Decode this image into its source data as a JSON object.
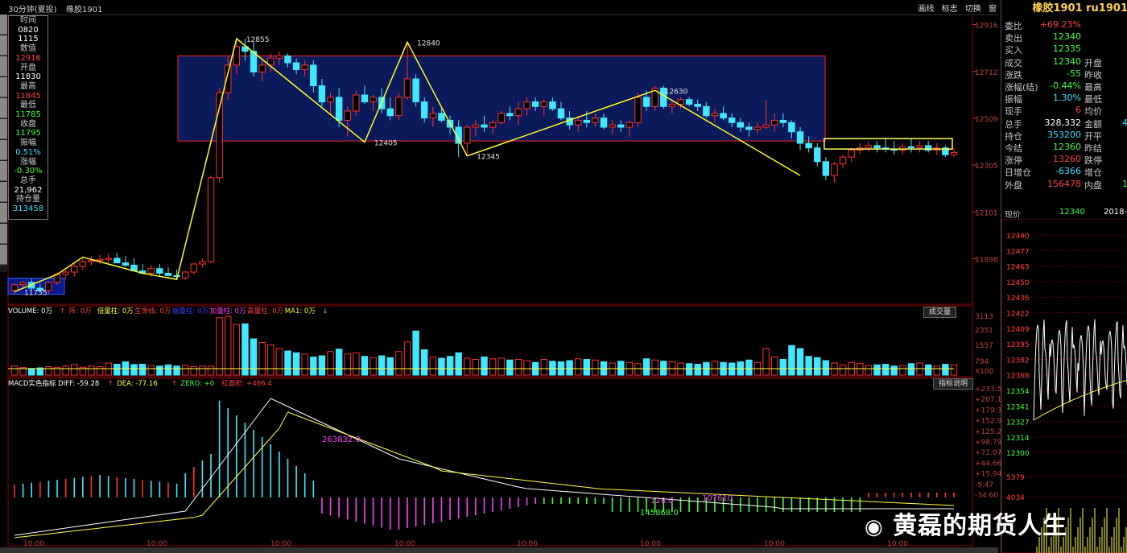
{
  "title_bar": {
    "period": "30分钟(夏投)",
    "symbol": "橡胶1901",
    "window_buttons": [
      "画线",
      "标志",
      "切换",
      "窗"
    ]
  },
  "info_box": {
    "rows": [
      {
        "text": "时间",
        "c": "g"
      },
      {
        "text": "0820",
        "c": "w"
      },
      {
        "text": "1115",
        "c": "w"
      },
      {
        "text": "数值",
        "c": "g"
      },
      {
        "text": "12916",
        "c": "r"
      },
      {
        "text": "开盘",
        "c": "g"
      },
      {
        "text": "11830",
        "c": "w"
      },
      {
        "text": "最高",
        "c": "g"
      },
      {
        "text": "11845",
        "c": "r"
      },
      {
        "text": "最低",
        "c": "g"
      },
      {
        "text": "11785",
        "c": "gr"
      },
      {
        "text": "收盘",
        "c": "g"
      },
      {
        "text": "11795",
        "c": "gr"
      },
      {
        "text": "振幅",
        "c": "g"
      },
      {
        "text": "0.51%",
        "c": "cy"
      },
      {
        "text": "涨幅",
        "c": "g"
      },
      {
        "text": "-0.30%",
        "c": "gr"
      },
      {
        "text": "总手",
        "c": "g"
      },
      {
        "text": "21,962",
        "c": "w"
      },
      {
        "text": "持仓量",
        "c": "g"
      },
      {
        "text": "313458",
        "c": "cy"
      }
    ]
  },
  "right_panel": {
    "title": "橡胶1901 ru1901",
    "rows": [
      {
        "l1": "委比",
        "v1": "+69.23%",
        "c1": "#ff4040",
        "l2": "",
        "v2": "",
        "c2": "#fff"
      },
      {
        "l1": "卖出",
        "v1": "12340",
        "c1": "#40ff40",
        "l2": "",
        "v2": "",
        "c2": "#fff"
      },
      {
        "l1": "买入",
        "v1": "12335",
        "c1": "#40ff40",
        "l2": "",
        "v2": "",
        "c2": "#fff"
      },
      {
        "l1": "成交",
        "v1": "12340",
        "c1": "#40ff40",
        "l2": "开盘",
        "v2": "",
        "c2": "#fff"
      },
      {
        "l1": "涨跌",
        "v1": "-55",
        "c1": "#40ff40",
        "l2": "昨收",
        "v2": "",
        "c2": "#fff"
      },
      {
        "l1": "涨幅(结)",
        "v1": "-0.44%",
        "c1": "#40ff40",
        "l2": "最高",
        "v2": "",
        "c2": "#fff"
      },
      {
        "l1": "振幅",
        "v1": "1.30%",
        "c1": "#40e0ff",
        "l2": "最低",
        "v2": "",
        "c2": "#fff"
      },
      {
        "l1": "现手",
        "v1": "6",
        "c1": "#ff4040",
        "l2": "均价",
        "v2": "",
        "c2": "#fff"
      },
      {
        "l1": "总手",
        "v1": "328,332",
        "c1": "#fff",
        "l2": "金额",
        "v2": "4",
        "c2": "#40e0ff"
      },
      {
        "l1": "持仓",
        "v1": "353200",
        "c1": "#40e0ff",
        "l2": "开平",
        "v2": "",
        "c2": "#fff"
      },
      {
        "l1": "今结",
        "v1": "12360",
        "c1": "#40ff40",
        "l2": "昨结",
        "v2": "",
        "c2": "#fff"
      },
      {
        "l1": "涨停",
        "v1": "13260",
        "c1": "#ff4040",
        "l2": "跌停",
        "v2": "",
        "c2": "#fff"
      },
      {
        "l1": "日增仓",
        "v1": "-6366",
        "c1": "#40e0ff",
        "l2": "增仓",
        "v2": "",
        "c2": "#fff"
      },
      {
        "l1": "外盘",
        "v1": "156478",
        "c1": "#ff4040",
        "l2": "内盘",
        "v2": "1",
        "c2": "#40ff40"
      }
    ],
    "price_label": "现价",
    "price_value": "12340",
    "date_label": "2018-0",
    "tick_labels": [
      "12490",
      "12477",
      "12463",
      "12450",
      "12436",
      "12422",
      "12409",
      "12395",
      "12382",
      "12368",
      "12354",
      "12341",
      "12327",
      "12314",
      "12300",
      "5379",
      "4034"
    ]
  },
  "buttons": {
    "volume_btn": "成交量",
    "macd_btn": "指标说明"
  },
  "indicator_legends": {
    "volume": [
      {
        "t": "VOLUME: 0万",
        "c": "#fff"
      },
      {
        "t": "↑",
        "c": "#ff4040"
      },
      {
        "t": "阵: 0万",
        "c": "#ff4040"
      },
      {
        "t": "倍量柱: 0万",
        "c": "#ffff40"
      },
      {
        "t": "生命线: 0万",
        "c": "#ff4040"
      },
      {
        "t": "缩量柱: 0万",
        "c": "#4040ff"
      },
      {
        "t": "加量柱: 0万",
        "c": "#ff40ff"
      },
      {
        "t": "高量柱: 0万",
        "c": "#ff4040"
      },
      {
        "t": "MA1: 0万",
        "c": "#ffff40"
      },
      {
        "t": "↓",
        "c": "#40e0ff"
      }
    ],
    "macd": [
      {
        "t": "MACD实色指标 DIFF: -59.28",
        "c": "#fff"
      },
      {
        "t": "↑",
        "c": "#ff4040"
      },
      {
        "t": "DEA: -77.16",
        "c": "#ffff40"
      },
      {
        "t": "↑",
        "c": "#ff4040"
      },
      {
        "t": "ZERO: +0",
        "c": "#40ff40"
      },
      {
        "t": "红面积: +466.4",
        "c": "#ff4040"
      }
    ]
  },
  "watermark": "黄磊的期货人生",
  "chart_data": {
    "type": "candlestick",
    "price_axis": {
      "ticks": [
        12916,
        12712,
        12509,
        12305,
        12101,
        11898
      ],
      "range": [
        11700,
        12960
      ]
    },
    "candles": [
      [
        11760,
        11790,
        11745,
        11785
      ],
      [
        11785,
        11800,
        11770,
        11795
      ],
      [
        11795,
        11810,
        11760,
        11770
      ],
      [
        11770,
        11790,
        11755,
        11760
      ],
      [
        11760,
        11800,
        11745,
        11795
      ],
      [
        11795,
        11840,
        11785,
        11830
      ],
      [
        11830,
        11850,
        11810,
        11840
      ],
      [
        11840,
        11880,
        11820,
        11865
      ],
      [
        11865,
        11900,
        11850,
        11885
      ],
      [
        11885,
        11910,
        11870,
        11890
      ],
      [
        11890,
        11915,
        11875,
        11895
      ],
      [
        11895,
        11920,
        11880,
        11900
      ],
      [
        11900,
        11925,
        11885,
        11880
      ],
      [
        11880,
        11910,
        11860,
        11870
      ],
      [
        11870,
        11900,
        11850,
        11845
      ],
      [
        11845,
        11875,
        11830,
        11835
      ],
      [
        11835,
        11870,
        11820,
        11855
      ],
      [
        11855,
        11875,
        11825,
        11835
      ],
      [
        11835,
        11860,
        11815,
        11825
      ],
      [
        11825,
        11850,
        11810,
        11820
      ],
      [
        11815,
        11845,
        11805,
        11840
      ],
      [
        11840,
        11880,
        11830,
        11875
      ],
      [
        11875,
        11900,
        11860,
        11885
      ],
      [
        11885,
        12260,
        11880,
        12250
      ],
      [
        12250,
        12640,
        12230,
        12620
      ],
      [
        12620,
        12780,
        12590,
        12740
      ],
      [
        12740,
        12855,
        12700,
        12820
      ],
      [
        12820,
        12855,
        12760,
        12800
      ],
      [
        12800,
        12840,
        12690,
        12710
      ],
      [
        12710,
        12760,
        12670,
        12740
      ],
      [
        12740,
        12790,
        12710,
        12770
      ],
      [
        12770,
        12800,
        12740,
        12780
      ],
      [
        12780,
        12790,
        12730,
        12750
      ],
      [
        12750,
        12770,
        12700,
        12720
      ],
      [
        12720,
        12760,
        12690,
        12740
      ],
      [
        12740,
        12760,
        12620,
        12650
      ],
      [
        12650,
        12680,
        12560,
        12580
      ],
      [
        12580,
        12620,
        12530,
        12600
      ],
      [
        12600,
        12640,
        12470,
        12500
      ],
      [
        12500,
        12560,
        12430,
        12540
      ],
      [
        12540,
        12630,
        12520,
        12610
      ],
      [
        12610,
        12650,
        12570,
        12580
      ],
      [
        12580,
        12610,
        12540,
        12600
      ],
      [
        12600,
        12640,
        12530,
        12550
      ],
      [
        12550,
        12600,
        12500,
        12520
      ],
      [
        12520,
        12620,
        12500,
        12600
      ],
      [
        12600,
        12840,
        12590,
        12680
      ],
      [
        12680,
        12700,
        12560,
        12580
      ],
      [
        12580,
        12600,
        12490,
        12510
      ],
      [
        12510,
        12560,
        12470,
        12530
      ],
      [
        12530,
        12560,
        12490,
        12500
      ],
      [
        12500,
        12520,
        12440,
        12470
      ],
      [
        12470,
        12500,
        12340,
        12400
      ],
      [
        12400,
        12480,
        12350,
        12470
      ],
      [
        12470,
        12500,
        12430,
        12480
      ],
      [
        12480,
        12520,
        12450,
        12470
      ],
      [
        12470,
        12500,
        12440,
        12490
      ],
      [
        12490,
        12540,
        12480,
        12530
      ],
      [
        12530,
        12560,
        12500,
        12520
      ],
      [
        12520,
        12580,
        12480,
        12550
      ],
      [
        12550,
        12600,
        12520,
        12580
      ],
      [
        12580,
        12600,
        12540,
        12560
      ],
      [
        12560,
        12590,
        12520,
        12580
      ],
      [
        12580,
        12600,
        12540,
        12550
      ],
      [
        12550,
        12580,
        12500,
        12510
      ],
      [
        12510,
        12540,
        12460,
        12480
      ],
      [
        12480,
        12520,
        12450,
        12500
      ],
      [
        12500,
        12540,
        12470,
        12490
      ],
      [
        12490,
        12530,
        12470,
        12510
      ],
      [
        12510,
        12530,
        12460,
        12470
      ],
      [
        12470,
        12500,
        12440,
        12480
      ],
      [
        12480,
        12500,
        12450,
        12470
      ],
      [
        12470,
        12500,
        12430,
        12490
      ],
      [
        12490,
        12620,
        12470,
        12600
      ],
      [
        12600,
        12630,
        12540,
        12560
      ],
      [
        12560,
        12650,
        12540,
        12640
      ],
      [
        12640,
        12650,
        12550,
        12560
      ],
      [
        12560,
        12590,
        12530,
        12570
      ],
      [
        12570,
        12600,
        12550,
        12590
      ],
      [
        12590,
        12600,
        12560,
        12570
      ],
      [
        12570,
        12590,
        12540,
        12560
      ],
      [
        12560,
        12580,
        12510,
        12520
      ],
      [
        12520,
        12550,
        12490,
        12530
      ],
      [
        12530,
        12560,
        12500,
        12510
      ],
      [
        12510,
        12530,
        12470,
        12490
      ],
      [
        12490,
        12510,
        12450,
        12470
      ],
      [
        12470,
        12490,
        12430,
        12460
      ],
      [
        12460,
        12490,
        12440,
        12470
      ],
      [
        12470,
        12590,
        12460,
        12480
      ],
      [
        12480,
        12530,
        12450,
        12500
      ],
      [
        12500,
        12530,
        12470,
        12490
      ],
      [
        12490,
        12500,
        12420,
        12450
      ],
      [
        12450,
        12470,
        12370,
        12400
      ],
      [
        12400,
        12430,
        12360,
        12380
      ],
      [
        12380,
        12400,
        12300,
        12320
      ],
      [
        12320,
        12340,
        12240,
        12260
      ],
      [
        12260,
        12320,
        12230,
        12310
      ],
      [
        12310,
        12350,
        12290,
        12340
      ],
      [
        12340,
        12380,
        12320,
        12370
      ],
      [
        12370,
        12400,
        12350,
        12380
      ],
      [
        12380,
        12410,
        12360,
        12390
      ],
      [
        12390,
        12410,
        12360,
        12380
      ],
      [
        12380,
        12420,
        12360,
        12375
      ],
      [
        12375,
        12410,
        12350,
        12370
      ],
      [
        12370,
        12400,
        12350,
        12385
      ],
      [
        12385,
        12420,
        12360,
        12380
      ],
      [
        12380,
        12410,
        12360,
        12390
      ],
      [
        12390,
        12410,
        12360,
        12370
      ],
      [
        12370,
        12400,
        12350,
        12380
      ],
      [
        12380,
        12390,
        12340,
        12350
      ],
      [
        12350,
        12380,
        12340,
        12360
      ]
    ],
    "annotations": [
      {
        "label": "11755",
        "price": 11755
      },
      {
        "label": "12855",
        "price": 12855
      },
      {
        "label": "12405",
        "price": 12405
      },
      {
        "label": "12840",
        "price": 12840
      },
      {
        "label": "12345",
        "price": 12345
      },
      {
        "label": "12630",
        "price": 12630
      }
    ],
    "volume_axis": {
      "ticks": [
        "3113",
        "2351",
        "1557",
        "794",
        "X100"
      ]
    },
    "volume": [
      30,
      25,
      22,
      24,
      28,
      26,
      30,
      35,
      26,
      30,
      28,
      40,
      36,
      44,
      35,
      36,
      32,
      30,
      34,
      30,
      32,
      28,
      30,
      30,
      190,
      195,
      168,
      170,
      120,
      108,
      100,
      88,
      80,
      74,
      70,
      60,
      64,
      78,
      86,
      70,
      74,
      62,
      58,
      64,
      58,
      78,
      110,
      146,
      84,
      60,
      56,
      62,
      74,
      56,
      52,
      60,
      54,
      56,
      50,
      52,
      48,
      42,
      52,
      46,
      44,
      48,
      54,
      52,
      50,
      44,
      40,
      46,
      42,
      38,
      54,
      50,
      46,
      44,
      40,
      38,
      36,
      42,
      46,
      42,
      40,
      44,
      50,
      42,
      88,
      60,
      52,
      98,
      88,
      62,
      58,
      48,
      40,
      34,
      42,
      38,
      32,
      34,
      36,
      30,
      32,
      38,
      40,
      34,
      30,
      36,
      34
    ],
    "macd_axis": {
      "ticks": [
        "+233.5",
        "+207.1",
        "+179.3",
        "+152.9",
        "+125.2",
        "+98.79",
        "+71.07",
        "+44.66",
        "+15.94",
        "-9.47",
        "-34.60"
      ]
    },
    "macd_annotations": [
      {
        "label": "263832.0",
        "value": 40
      },
      {
        "label": "128.0",
        "value": 0
      },
      {
        "label": "145868.0",
        "value": -30
      },
      {
        "label": "107610",
        "value": -10
      }
    ],
    "x_ticks": [
      "10:00",
      "10:00",
      "10:00",
      "10:00",
      "10:00",
      "10:00",
      "10:00",
      "10:00"
    ]
  }
}
